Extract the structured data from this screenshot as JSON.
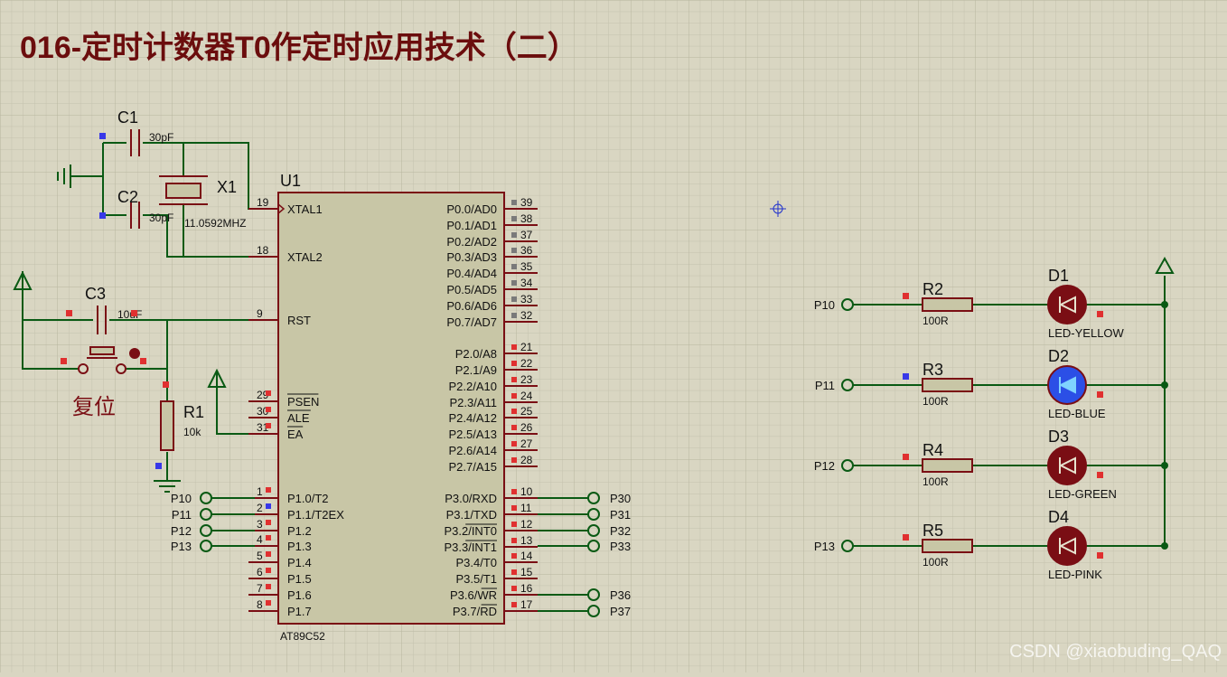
{
  "title": "016-定时计数器T0作定时应用技术（二）",
  "watermark": "CSDN @xiaobuding_QAQ",
  "colors": {
    "background": "#d9d6c2",
    "grid": "#c4c1ad",
    "grid_major": "#b8b59f",
    "wire": "#0a5a14",
    "component": "#7a0e14",
    "chip_fill": "#c8c6a6",
    "title": "#6b0d0d",
    "pin_red": "#e03030",
    "pin_blue": "#3838e8",
    "pin_gray": "#7a7a7a",
    "led_blue": "#2b4fe6",
    "led_dark": "#7a0e14"
  },
  "chip": {
    "ref": "U1",
    "part": "AT89C52",
    "left_pins": [
      {
        "num": "19",
        "name": "XTAL1"
      },
      {
        "num": "18",
        "name": "XTAL2"
      },
      {
        "num": "9",
        "name": "RST"
      },
      {
        "num": "29",
        "name": "PSEN"
      },
      {
        "num": "30",
        "name": "ALE"
      },
      {
        "num": "31",
        "name": "EA"
      },
      {
        "num": "1",
        "name": "P1.0/T2"
      },
      {
        "num": "2",
        "name": "P1.1/T2EX"
      },
      {
        "num": "3",
        "name": "P1.2"
      },
      {
        "num": "4",
        "name": "P1.3"
      },
      {
        "num": "5",
        "name": "P1.4"
      },
      {
        "num": "6",
        "name": "P1.5"
      },
      {
        "num": "7",
        "name": "P1.6"
      },
      {
        "num": "8",
        "name": "P1.7"
      }
    ],
    "right_pins": [
      {
        "num": "39",
        "name": "P0.0/AD0"
      },
      {
        "num": "38",
        "name": "P0.1/AD1"
      },
      {
        "num": "37",
        "name": "P0.2/AD2"
      },
      {
        "num": "36",
        "name": "P0.3/AD3"
      },
      {
        "num": "35",
        "name": "P0.4/AD4"
      },
      {
        "num": "34",
        "name": "P0.5/AD5"
      },
      {
        "num": "33",
        "name": "P0.6/AD6"
      },
      {
        "num": "32",
        "name": "P0.7/AD7"
      },
      {
        "num": "21",
        "name": "P2.0/A8"
      },
      {
        "num": "22",
        "name": "P2.1/A9"
      },
      {
        "num": "23",
        "name": "P2.2/A10"
      },
      {
        "num": "24",
        "name": "P2.3/A11"
      },
      {
        "num": "25",
        "name": "P2.4/A12"
      },
      {
        "num": "26",
        "name": "P2.5/A13"
      },
      {
        "num": "27",
        "name": "P2.6/A14"
      },
      {
        "num": "28",
        "name": "P2.7/A15"
      },
      {
        "num": "10",
        "name": "P3.0/RXD"
      },
      {
        "num": "11",
        "name": "P3.1/TXD"
      },
      {
        "num": "12",
        "name": "P3.2/INT0"
      },
      {
        "num": "13",
        "name": "P3.3/INT1"
      },
      {
        "num": "14",
        "name": "P3.4/T0"
      },
      {
        "num": "15",
        "name": "P3.5/T1"
      },
      {
        "num": "16",
        "name": "P3.6/WR"
      },
      {
        "num": "17",
        "name": "P3.7/RD"
      }
    ]
  },
  "crystal": {
    "ref": "X1",
    "value": "11.0592MHZ"
  },
  "capacitors": [
    {
      "ref": "C1",
      "value": "30pF"
    },
    {
      "ref": "C2",
      "value": "30pF"
    },
    {
      "ref": "C3",
      "value": "10uF"
    }
  ],
  "reset": {
    "label": "复位",
    "resistor_ref": "R1",
    "resistor_value": "10k"
  },
  "chip_terminals_left": [
    "P10",
    "P11",
    "P12",
    "P13"
  ],
  "chip_terminals_right": [
    "P30",
    "P31",
    "P32",
    "P33",
    "P36",
    "P37"
  ],
  "led_rows": [
    {
      "terminal": "P10",
      "resistor": "R2",
      "resistor_value": "100R",
      "led": "D1",
      "led_type": "LED-YELLOW",
      "lit": false
    },
    {
      "terminal": "P11",
      "resistor": "R3",
      "resistor_value": "100R",
      "led": "D2",
      "led_type": "LED-BLUE",
      "lit": true
    },
    {
      "terminal": "P12",
      "resistor": "R4",
      "resistor_value": "100R",
      "led": "D3",
      "led_type": "LED-GREEN",
      "lit": false
    },
    {
      "terminal": "P13",
      "resistor": "R5",
      "resistor_value": "100R",
      "led": "D4",
      "led_type": "LED-PINK",
      "lit": false
    }
  ]
}
